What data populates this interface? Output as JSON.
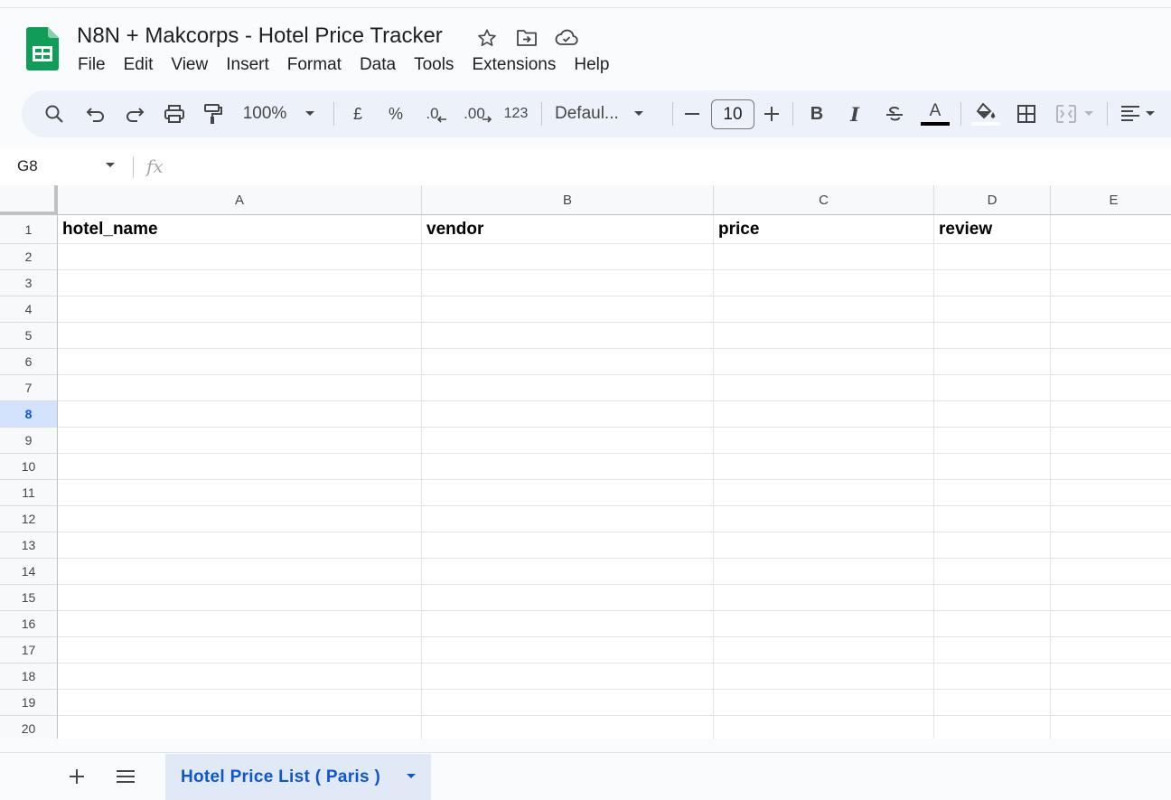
{
  "app": {
    "title": "N8N + Makcorps - Hotel Price Tracker",
    "brand_color": "#0f9d58",
    "accent_color": "#0b57d0"
  },
  "menu": [
    "File",
    "Edit",
    "View",
    "Insert",
    "Format",
    "Data",
    "Tools",
    "Extensions",
    "Help"
  ],
  "toolbar": {
    "zoom": "100%",
    "currency": "£",
    "percent": "%",
    "decrease_decimal": ".0",
    "increase_decimal": ".00",
    "number_format": "123",
    "font_family": "Defaul...",
    "font_size": "10",
    "bold": "B",
    "italic": "I",
    "text_color_letter": "A"
  },
  "formula_bar": {
    "cell_ref": "G8",
    "fx": "fx",
    "content": ""
  },
  "grid": {
    "columns": [
      "A",
      "B",
      "C",
      "D",
      "E"
    ],
    "rows": [
      "1",
      "2",
      "3",
      "4",
      "5",
      "6",
      "7",
      "8",
      "9",
      "10",
      "11",
      "12",
      "13",
      "14",
      "15",
      "16",
      "17",
      "18",
      "19",
      "20"
    ],
    "selected_row": "8",
    "header_row": [
      "hotel_name",
      "vendor",
      "price",
      "review",
      ""
    ]
  },
  "sheets": [
    {
      "name": "Hotel Price List ( Paris )",
      "active": true
    }
  ]
}
